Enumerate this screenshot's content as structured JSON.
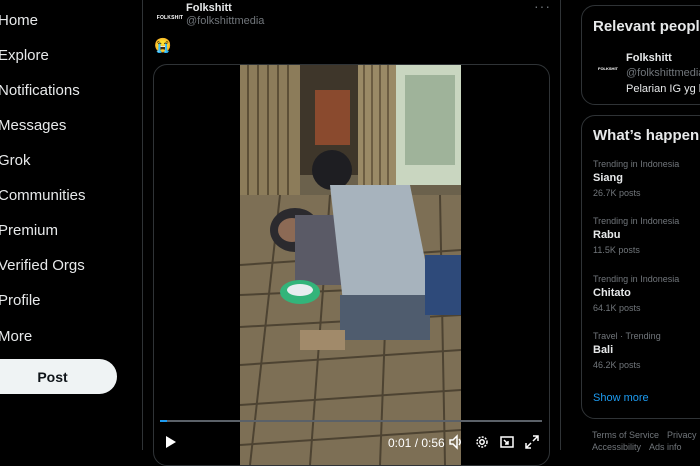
{
  "nav": {
    "items": [
      {
        "label": "Home"
      },
      {
        "label": "Explore"
      },
      {
        "label": "Notifications"
      },
      {
        "label": "Messages"
      },
      {
        "label": "Grok"
      },
      {
        "label": "Communities"
      },
      {
        "label": "Premium"
      },
      {
        "label": "Verified Orgs"
      },
      {
        "label": "Profile"
      },
      {
        "label": "More"
      }
    ],
    "post_label": "Post"
  },
  "tweet": {
    "avatar_text": "FOLKSHIT",
    "author_name": "Folkshitt",
    "author_handle": "@folkshittmedia",
    "more_label": "···",
    "body": "😭",
    "video": {
      "time": "0:01 / 0:56",
      "progress": 0.018
    }
  },
  "relevant": {
    "title": "Relevant people",
    "avatar_text": "FOLKSHIT",
    "name": "Folkshitt",
    "handle": "@folkshittmedia",
    "bio": "Pelarian IG yg b"
  },
  "trends": {
    "title": "What’s happening",
    "items": [
      {
        "context": "Trending in Indonesia",
        "name": "Siang",
        "count": "26.7K posts"
      },
      {
        "context": "Trending in Indonesia",
        "name": "Rabu",
        "count": "11.5K posts"
      },
      {
        "context": "Trending in Indonesia",
        "name": "Chitato",
        "count": "64.1K posts"
      },
      {
        "context": "Travel · Trending",
        "name": "Bali",
        "count": "46.2K posts"
      }
    ],
    "show_more": "Show more"
  },
  "footer": {
    "terms": "Terms of Service",
    "privacy": "Privacy",
    "accessibility": "Accessibility",
    "ads_info": "Ads info"
  },
  "colors": {
    "accent": "#1d9bf0",
    "background": "#000000",
    "muted": "#71767b",
    "border": "#2f3336"
  }
}
